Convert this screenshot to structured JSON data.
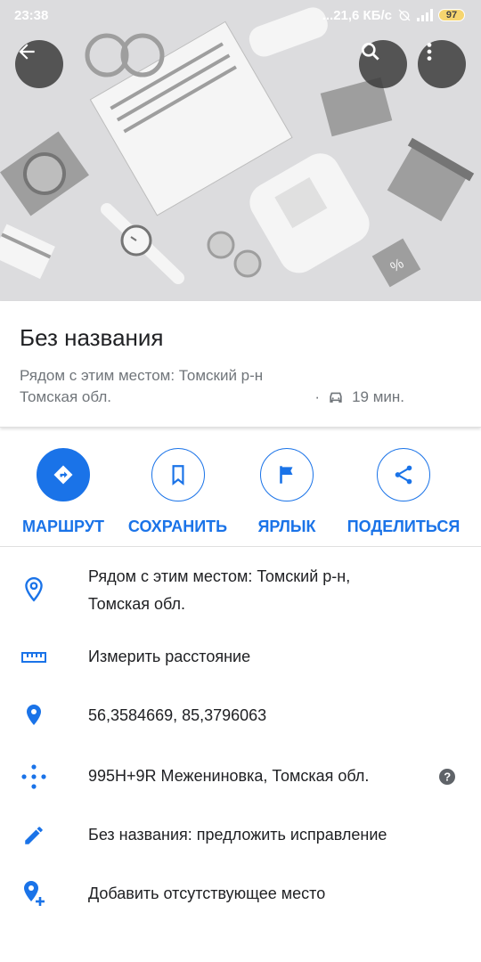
{
  "status_bar": {
    "time": "23:38",
    "network_speed": "...21,6 КБ/с",
    "battery": "97",
    "icons": [
      "alarm-off-icon",
      "signal-icon",
      "battery-icon"
    ]
  },
  "hero": {
    "back_icon": "arrow-back-icon",
    "search_icon": "search-icon",
    "more_icon": "more-vert-icon"
  },
  "place": {
    "title": "Без названия",
    "subtitle_line1": "Рядом с этим местом: Томский р-н",
    "subtitle_line2": "Томская обл.",
    "travel_time": "19 мин.",
    "travel_icon": "car-icon"
  },
  "actions": [
    {
      "label": "МАРШРУТ",
      "icon": "directions-icon"
    },
    {
      "label": "СОХРАНИТЬ",
      "icon": "bookmark-icon"
    },
    {
      "label": "ЯРЛЫК",
      "icon": "flag-icon"
    },
    {
      "label": "ПОДЕЛИТЬСЯ",
      "icon": "share-icon"
    }
  ],
  "info": [
    {
      "icon": "location-outline-icon",
      "line1": "Рядом с этим местом: Томский р-н,",
      "line2": "Томская обл."
    },
    {
      "icon": "ruler-icon",
      "line1": "Измерить расстояние"
    },
    {
      "icon": "location-pin-icon",
      "line1": "56,3584669, 85,3796063"
    },
    {
      "icon": "plus-code-icon",
      "line1": "995H+9R Межениновка, Томская обл.",
      "help_icon": "help-icon"
    },
    {
      "icon": "edit-pencil-icon",
      "line1": "Без названия: предложить исправление"
    },
    {
      "icon": "add-location-icon",
      "line1": "Добавить отсутствующее место"
    }
  ],
  "colors": {
    "accent": "#1a73e8",
    "text": "#202124",
    "secondary": "#70757a"
  }
}
